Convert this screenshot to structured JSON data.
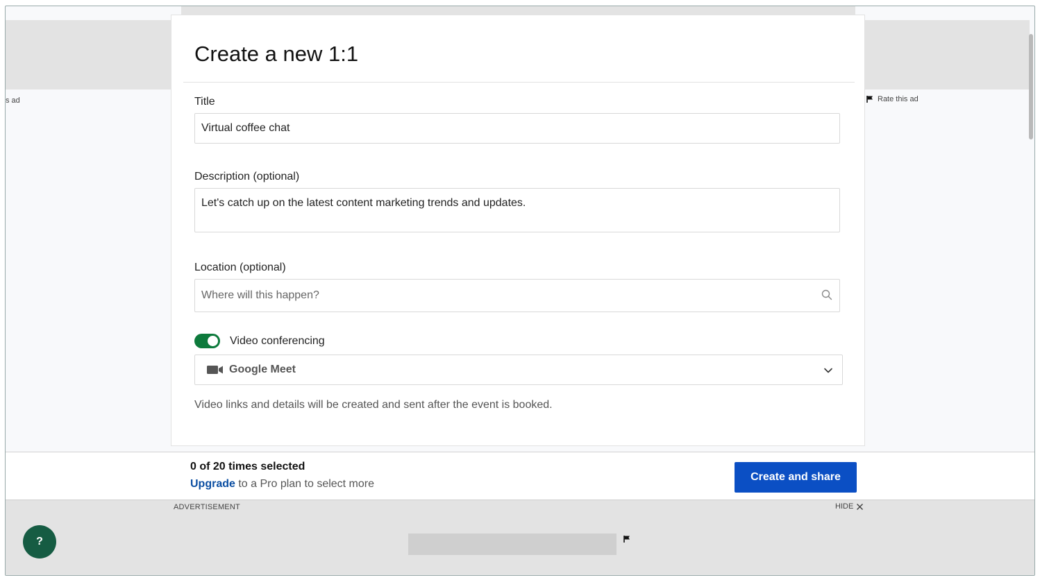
{
  "ads": {
    "left_label": "s ad",
    "rate_label": "Rate this ad",
    "advertisement_label": "ADVERTISEMENT",
    "hide_label": "HIDE"
  },
  "modal": {
    "title": "Create a new 1:1",
    "title_field": {
      "label": "Title",
      "value": "Virtual coffee chat"
    },
    "description_field": {
      "label": "Description (optional)",
      "value": "Let's catch up on the latest content marketing trends and updates."
    },
    "location_field": {
      "label": "Location (optional)",
      "placeholder": "Where will this happen?"
    },
    "video": {
      "label": "Video conferencing",
      "enabled": true,
      "selected_provider": "Google Meet",
      "help_text": "Video links and details will be created and sent after the event is booked."
    }
  },
  "footer": {
    "selection_count": "0 of 20 times selected",
    "upgrade_link": "Upgrade",
    "upgrade_text": " to a Pro plan to select more",
    "create_button": "Create and share"
  },
  "help": {
    "label": "?"
  },
  "colors": {
    "toggle_on": "#0d7a3c",
    "primary_button": "#0b4fc4",
    "link": "#0b4ea2",
    "help_button": "#165c43"
  }
}
